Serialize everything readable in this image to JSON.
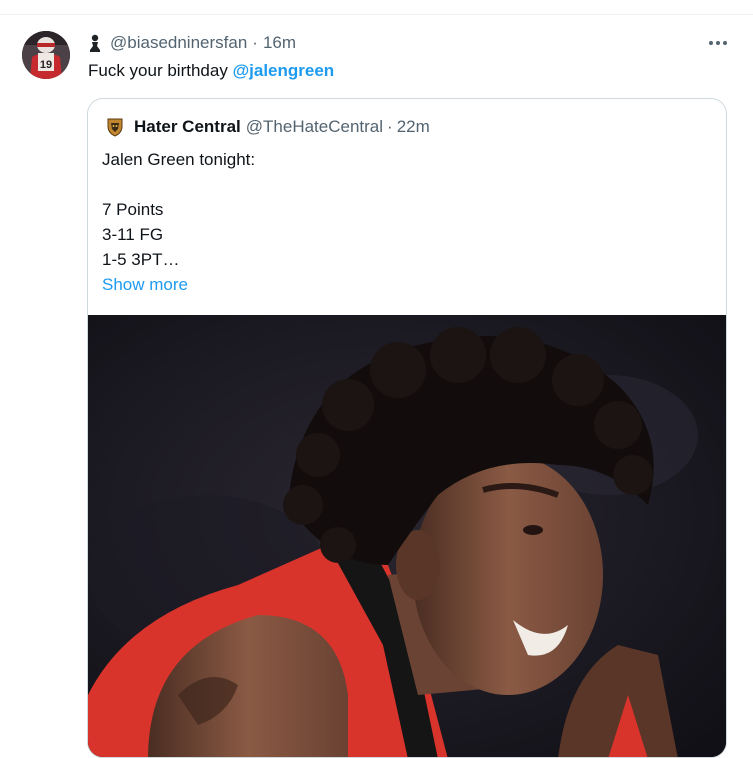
{
  "tweet": {
    "handle": "@biasedninersfan",
    "separator": "·",
    "time": "16m",
    "text_prefix": "Fuck your birthday ",
    "mention": "@jalengreen"
  },
  "quote": {
    "name": "Hater Central",
    "handle": "@TheHateCentral",
    "separator": "·",
    "time": "22m",
    "lines": [
      "Jalen Green tonight:",
      "",
      "7 Points",
      "3-11 FG",
      "1-5 3PT…"
    ],
    "show_more": "Show more"
  },
  "avatar_jersey_number": "19",
  "colors": {
    "link_blue": "#1d9bf0",
    "secondary_text": "#536471",
    "border": "#cfd9de",
    "jersey_red": "#d8342c"
  },
  "icons": {
    "author_badge": "pawn-icon",
    "more": "more-dots-icon",
    "quote_avatar": "shield-logo-icon"
  }
}
